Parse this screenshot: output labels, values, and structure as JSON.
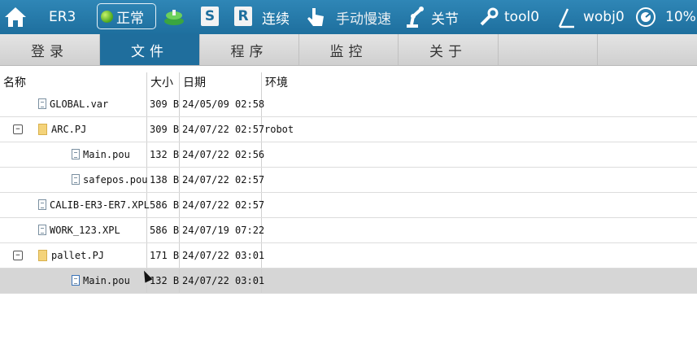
{
  "topbar": {
    "robot_model": "ER3",
    "status": "正常",
    "s_button": "S",
    "r_button": "R",
    "run_mode": "连续",
    "jog_mode": "手动慢速",
    "servo": "关节",
    "tool": "tool0",
    "wobj": "wobj0",
    "speed": "10%"
  },
  "menu": {
    "items": [
      "登录",
      "文件",
      "程序",
      "监控",
      "关于"
    ],
    "active": "文件"
  },
  "table": {
    "headers": {
      "name": "名称",
      "size": "大小",
      "date": "日期",
      "env": "环境"
    },
    "rows": [
      {
        "name": "GLOBAL.var",
        "size": "309 B",
        "date": "24/05/09 02:58",
        "env": ""
      },
      {
        "name": "ARC.PJ",
        "size": "309 B",
        "date": "24/07/22 02:57",
        "env": "robot"
      },
      {
        "name": "Main.pou",
        "size": "132 B",
        "date": "24/07/22 02:56",
        "env": ""
      },
      {
        "name": "safepos.pou",
        "size": "138 B",
        "date": "24/07/22 02:57",
        "env": ""
      },
      {
        "name": "CALIB-ER3-ER7.XPL",
        "size": "586 B",
        "date": "24/07/22 02:57",
        "env": ""
      },
      {
        "name": "WORK_123.XPL",
        "size": "586 B",
        "date": "24/07/19 07:22",
        "env": ""
      },
      {
        "name": "pallet.PJ",
        "size": "171 B",
        "date": "24/07/22 03:01",
        "env": ""
      },
      {
        "name": "Main.pou",
        "size": "132 B",
        "date": "24/07/22 03:01",
        "env": ""
      }
    ]
  },
  "colors": {
    "topbar": "#1e6f9e",
    "active_tab": "#1f6e9d",
    "selected_row": "#d6d6d6"
  }
}
